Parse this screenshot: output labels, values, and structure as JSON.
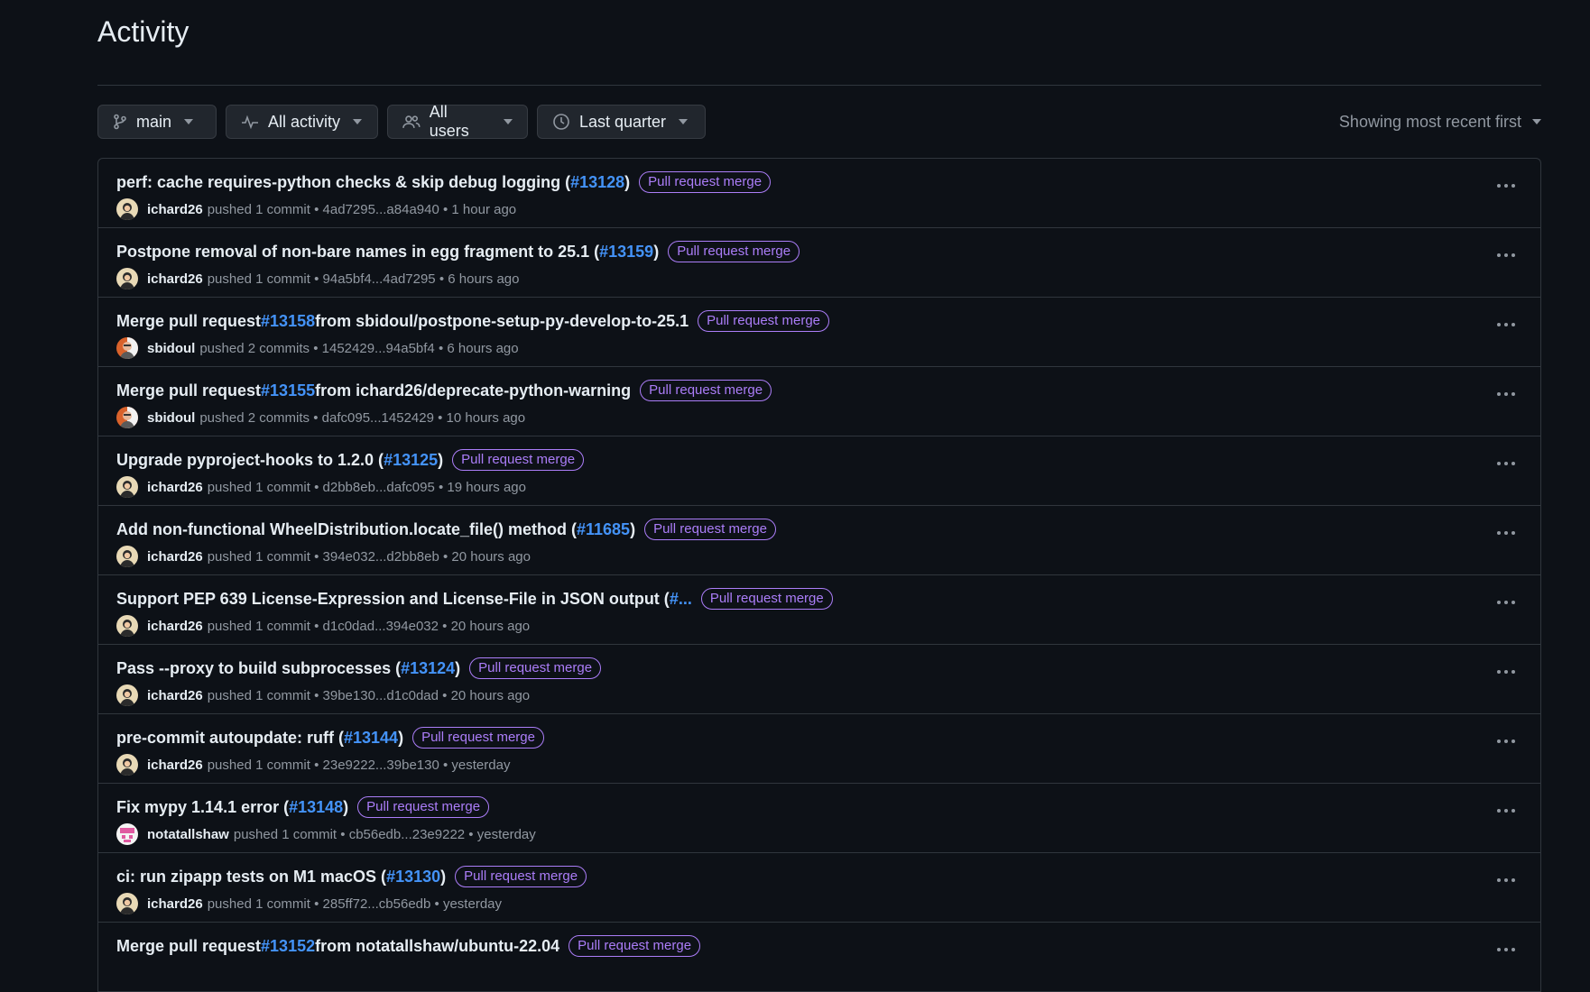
{
  "page": {
    "title": "Activity"
  },
  "filters": {
    "branch": "main",
    "activity": "All activity",
    "users": "All users",
    "period": "Last quarter",
    "sort": "Showing most recent first"
  },
  "rows": [
    {
      "pre": "perf: cache requires-python checks & skip debug logging (",
      "pr": "#13128",
      "post": ")",
      "badge": "Pull request merge",
      "author": "ichard26",
      "pushed": "pushed 1 commit",
      "range": "4ad7295...a84a940",
      "time": "1 hour ago",
      "avatar": "ichard"
    },
    {
      "pre": "Postpone removal of non-bare names in egg fragment to 25.1 (",
      "pr": "#13159",
      "post": ")",
      "badge": "Pull request merge",
      "author": "ichard26",
      "pushed": "pushed 1 commit",
      "range": "94a5bf4...4ad7295",
      "time": "6 hours ago",
      "avatar": "ichard"
    },
    {
      "pre": "Merge pull request ",
      "pr": "#13158",
      "post": " from sbidoul/postpone-setup-py-develop-to-25.1",
      "badge": "Pull request merge",
      "author": "sbidoul",
      "pushed": "pushed 2 commits",
      "range": "1452429...94a5bf4",
      "time": "6 hours ago",
      "avatar": "sbidoul"
    },
    {
      "pre": "Merge pull request ",
      "pr": "#13155",
      "post": " from ichard26/deprecate-python-warning",
      "badge": "Pull request merge",
      "author": "sbidoul",
      "pushed": "pushed 2 commits",
      "range": "dafc095...1452429",
      "time": "10 hours ago",
      "avatar": "sbidoul"
    },
    {
      "pre": "Upgrade pyproject-hooks to 1.2.0 (",
      "pr": "#13125",
      "post": ")",
      "badge": "Pull request merge",
      "author": "ichard26",
      "pushed": "pushed 1 commit",
      "range": "d2bb8eb...dafc095",
      "time": "19 hours ago",
      "avatar": "ichard"
    },
    {
      "pre": "Add non-functional WheelDistribution.locate_file() method (",
      "pr": "#11685",
      "post": ")",
      "badge": "Pull request merge",
      "author": "ichard26",
      "pushed": "pushed 1 commit",
      "range": "394e032...d2bb8eb",
      "time": "20 hours ago",
      "avatar": "ichard"
    },
    {
      "pre": "Support PEP 639 License-Expression and License-File in JSON output (",
      "pr": "#...",
      "post": "",
      "badge": "Pull request merge",
      "author": "ichard26",
      "pushed": "pushed 1 commit",
      "range": "d1c0dad...394e032",
      "time": "20 hours ago",
      "avatar": "ichard"
    },
    {
      "pre": "Pass --proxy to build subprocesses (",
      "pr": "#13124",
      "post": ")",
      "badge": "Pull request merge",
      "author": "ichard26",
      "pushed": "pushed 1 commit",
      "range": "39be130...d1c0dad",
      "time": "20 hours ago",
      "avatar": "ichard"
    },
    {
      "pre": "pre-commit autoupdate: ruff (",
      "pr": "#13144",
      "post": ")",
      "badge": "Pull request merge",
      "author": "ichard26",
      "pushed": "pushed 1 commit",
      "range": "23e9222...39be130",
      "time": "yesterday",
      "avatar": "ichard"
    },
    {
      "pre": "Fix mypy 1.14.1 error (",
      "pr": "#13148",
      "post": ")",
      "badge": "Pull request merge",
      "author": "notatallshaw",
      "pushed": "pushed 1 commit",
      "range": "cb56edb...23e9222",
      "time": "yesterday",
      "avatar": "notatallshaw"
    },
    {
      "pre": "ci: run zipapp tests on M1 macOS (",
      "pr": "#13130",
      "post": ")",
      "badge": "Pull request merge",
      "author": "ichard26",
      "pushed": "pushed 1 commit",
      "range": "285ff72...cb56edb",
      "time": "yesterday",
      "avatar": "ichard"
    },
    {
      "pre": "Merge pull request ",
      "pr": "#13152",
      "post": " from notatallshaw/ubuntu-22.04",
      "badge": "Pull request merge",
      "author": "",
      "pushed": "",
      "range": "",
      "time": "",
      "avatar": ""
    }
  ],
  "icons": {
    "branch": "git-branch-icon",
    "activity": "pulse-icon",
    "users": "people-icon",
    "period": "clock-icon",
    "more": "kebab-horizontal-icon"
  },
  "colors": {
    "background": "#0d1117",
    "link": "#4493f8",
    "badge": "#ab7df8",
    "muted": "#9198a1",
    "border": "#30363d"
  }
}
